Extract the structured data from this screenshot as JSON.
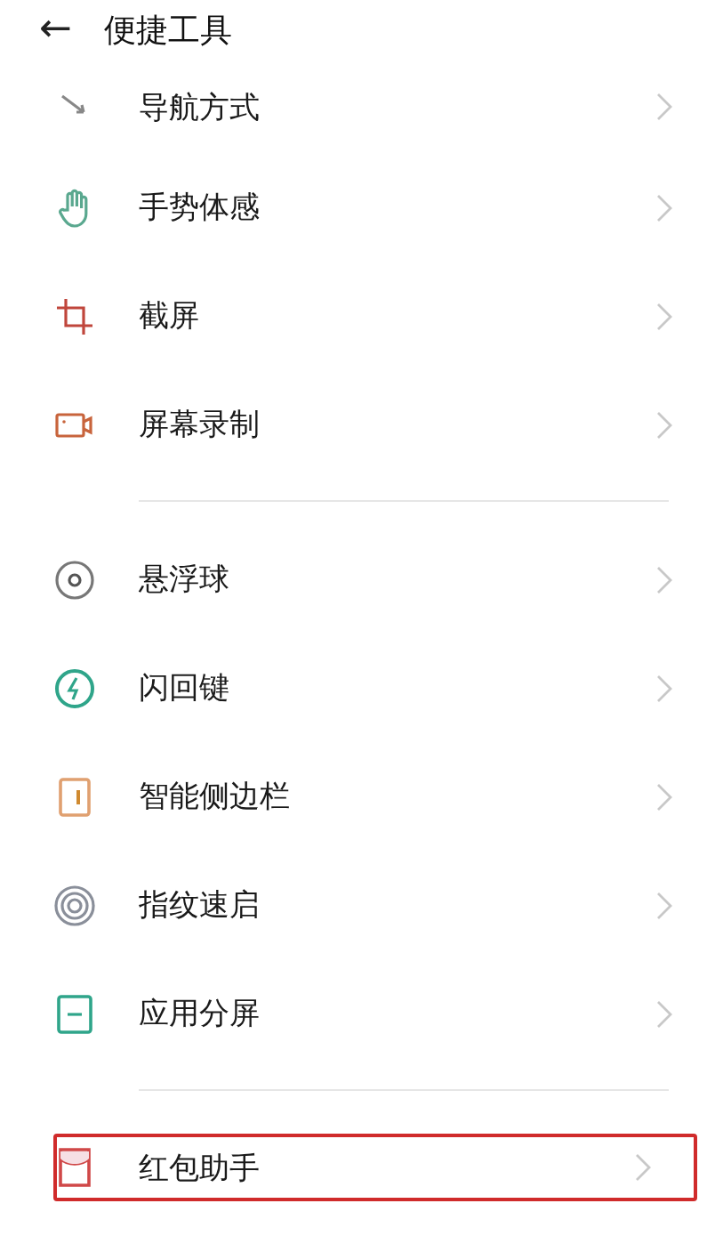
{
  "header": {
    "back": "←",
    "title": "便捷工具"
  },
  "sections": [
    {
      "items": [
        {
          "kind": "nav",
          "label": "导航方式",
          "highlighted": false
        },
        {
          "kind": "gesture",
          "label": "手势体感",
          "highlighted": false
        },
        {
          "kind": "screenshot",
          "label": "截屏",
          "highlighted": false
        },
        {
          "kind": "record",
          "label": "屏幕录制",
          "highlighted": false
        }
      ]
    },
    {
      "items": [
        {
          "kind": "ball",
          "label": "悬浮球",
          "highlighted": false
        },
        {
          "kind": "flash",
          "label": "闪回键",
          "highlighted": false
        },
        {
          "kind": "sidebar",
          "label": "智能侧边栏",
          "highlighted": false
        },
        {
          "kind": "fingerprint",
          "label": "指纹速启",
          "highlighted": false
        },
        {
          "kind": "split",
          "label": "应用分屏",
          "highlighted": false
        }
      ]
    },
    {
      "items": [
        {
          "kind": "redpacket",
          "label": "红包助手",
          "highlighted": true
        }
      ]
    }
  ]
}
